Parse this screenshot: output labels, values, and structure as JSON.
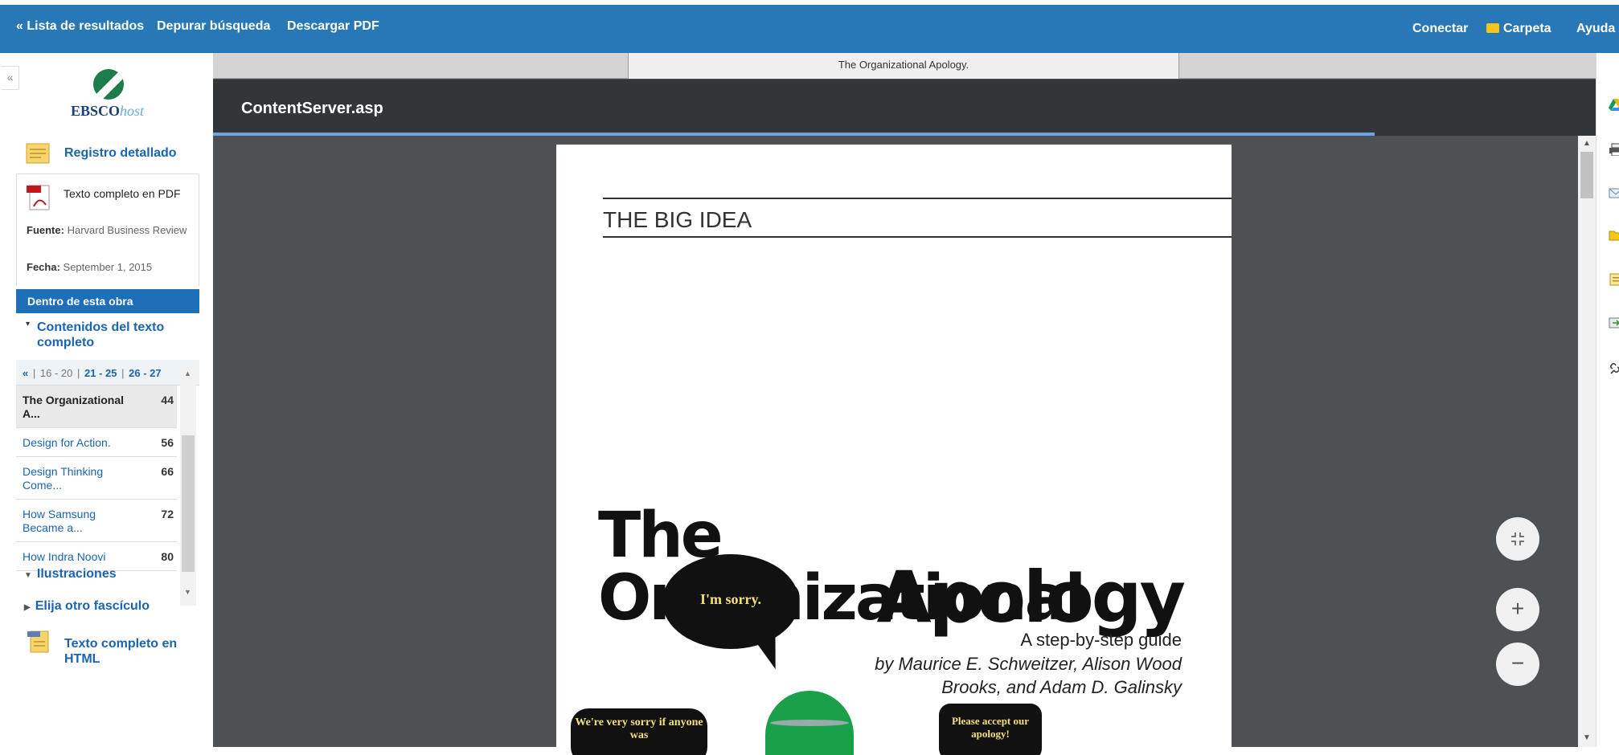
{
  "topbar": {
    "back_label": "« Lista de resultados",
    "refine_label": "Depurar búsqueda",
    "download_label": "Descargar PDF",
    "connect_label": "Conectar",
    "folder_label": "Carpeta",
    "help_label": "Ayuda"
  },
  "sidebar": {
    "collapse_label": "«",
    "logo_main": "EBSCO",
    "logo_suffix": "host",
    "detailed_record": "Registro detallado",
    "pdf_label": "Texto completo en PDF",
    "source_key": "Fuente:",
    "source_val": "Harvard Business Review",
    "date_key": "Fecha:",
    "date_val": "September 1, 2015",
    "section_title": "Dentro de esta obra",
    "toc_title": "Contenidos del texto completo",
    "pager": {
      "prev": "«",
      "current": "16 - 20",
      "link1": "21 - 25",
      "link2": "26 - 27"
    },
    "toc": [
      {
        "title": "The Organizational A...",
        "page": "44"
      },
      {
        "title": "Design for Action.",
        "page": "56"
      },
      {
        "title": "Design Thinking Come...",
        "page": "66"
      },
      {
        "title": "How Samsung Became a...",
        "page": "72"
      },
      {
        "title": "How Indra Noovi",
        "page": "80"
      }
    ],
    "illustrations": "Ilustraciones",
    "other_issue": "Elija otro fascículo",
    "html_label": "Texto completo en HTML"
  },
  "viewer": {
    "tab_title": "The Organizational Apology.",
    "file_name": "ContentServer.asp",
    "progress": 0.84,
    "page": {
      "section": "THE BIG IDEA",
      "title_line1": "The Organizational",
      "title_line2": "Apology",
      "subtitle": "A step-by-step guide",
      "byline": "by Maurice E. Schweitzer, Alison Wood Brooks, and Adam D. Galinsky",
      "bubble1": "I'm sorry.",
      "bubble2": "We're very sorry if anyone was",
      "bubble3": "Please accept our apology!"
    },
    "fit_icon": "fit-page-icon",
    "zoom_in": "+",
    "zoom_out": "−"
  },
  "colors": {
    "topbar": "#2878b8",
    "link": "#1a64b0",
    "viewer_bg": "#4e5154",
    "pdf_header": "#323639"
  }
}
